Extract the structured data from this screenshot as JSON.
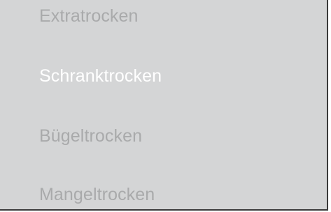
{
  "menu": {
    "items": [
      {
        "label": "Extratrocken",
        "selected": false
      },
      {
        "label": "Schranktrocken",
        "selected": true
      },
      {
        "label": "Bügeltrocken",
        "selected": false
      },
      {
        "label": "Mangeltrocken",
        "selected": false
      }
    ]
  },
  "colors": {
    "background": "#d4d5d6",
    "item_text": "#a9aaab",
    "selected_text": "#ffffff",
    "border": "#3a3a3a"
  }
}
